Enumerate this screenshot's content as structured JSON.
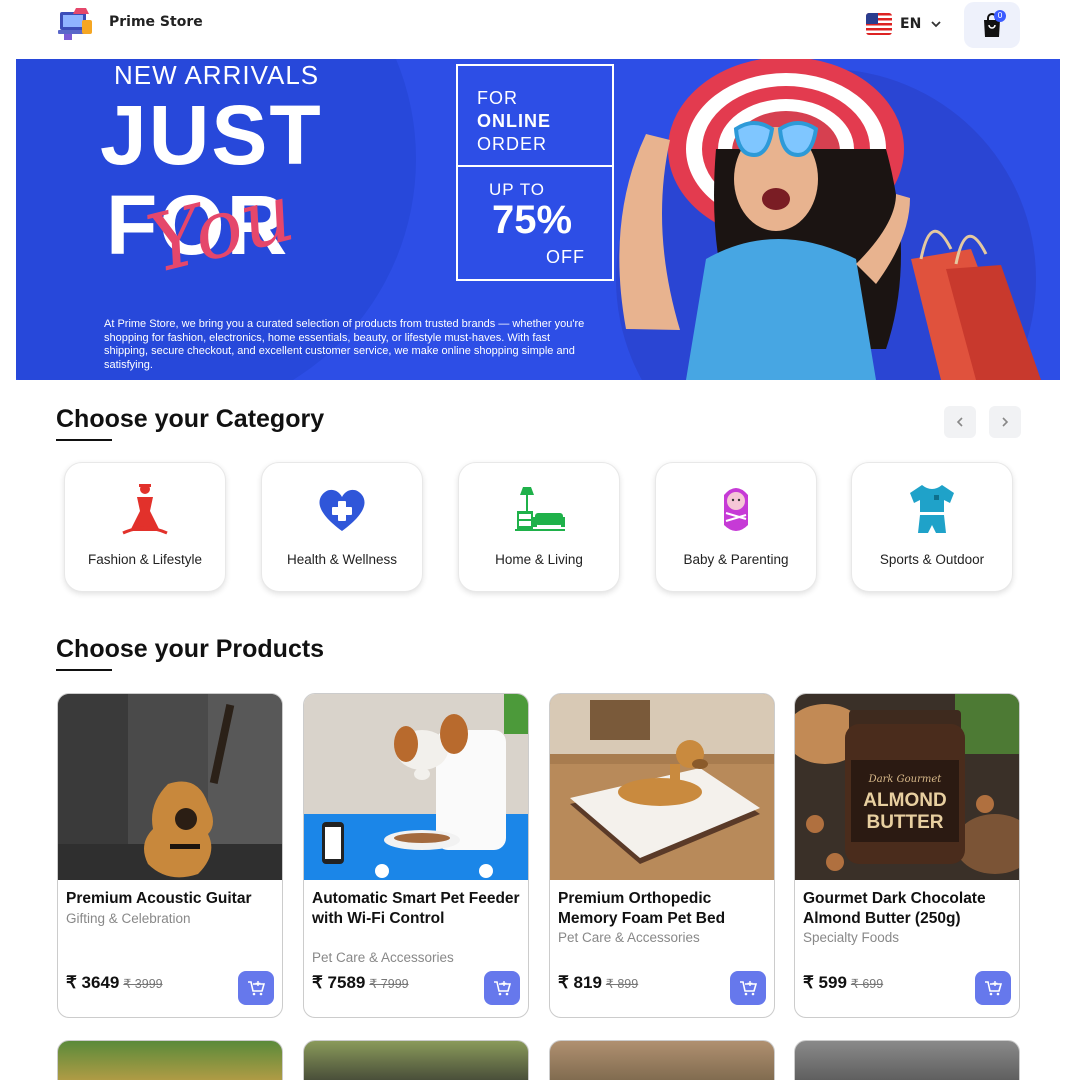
{
  "header": {
    "brand": "Prime Store",
    "language": "EN",
    "cart_count": "0"
  },
  "banner": {
    "kicker": "NEW ARRIVALS",
    "headline_1": "JUST",
    "headline_2": "FOR",
    "script": "You",
    "offer_line_1": "FOR",
    "offer_line_2": "ONLINE",
    "offer_line_3": "ORDER",
    "upto": "UP TO",
    "percent": "75%",
    "off": "OFF",
    "description": "At Prime Store, we bring you a curated selection of products from trusted brands — whether you're shopping for fashion, electronics, home essentials, beauty, or lifestyle must-haves. With fast shipping, secure checkout, and excellent customer service, we make online shopping simple and satisfying."
  },
  "categories": {
    "title": "Choose your Category",
    "items": [
      {
        "label": "Fashion & Lifestyle",
        "icon": "fashion-icon",
        "color": "#e2312b"
      },
      {
        "label": "Health & Wellness",
        "icon": "health-heart-icon",
        "color": "#2f56d9"
      },
      {
        "label": "Home & Living",
        "icon": "home-living-icon",
        "color": "#1fb14a"
      },
      {
        "label": "Baby & Parenting",
        "icon": "baby-icon",
        "color": "#c63ad6"
      },
      {
        "label": "Sports & Outdoor",
        "icon": "sports-jersey-icon",
        "color": "#1fa2c9"
      }
    ]
  },
  "products": {
    "title": "Choose your Products",
    "items": [
      {
        "name": "Premium Acoustic Guitar",
        "category": "Gifting & Celebration",
        "price": "₹ 3649",
        "mrp": "₹ 3999"
      },
      {
        "name": "Automatic Smart Pet Feeder with Wi-Fi Control",
        "category": "Pet Care & Accessories",
        "price": "₹ 7589",
        "mrp": "₹ 7999"
      },
      {
        "name": "Premium Orthopedic Memory Foam Pet Bed",
        "category": "Pet Care & Accessories",
        "price": "₹ 819",
        "mrp": "₹ 899"
      },
      {
        "name": "Gourmet Dark Chocolate Almond Butter (250g)",
        "category": "Specialty Foods",
        "price": "₹ 599",
        "mrp": "₹ 699"
      }
    ]
  },
  "jar_label": {
    "top": "Dark Gourmet",
    "line1": "ALMOND",
    "line2": "BUTTER"
  },
  "colors": {
    "accent": "#6678ec",
    "banner": "#2d4ee6",
    "script": "#e5476b"
  }
}
